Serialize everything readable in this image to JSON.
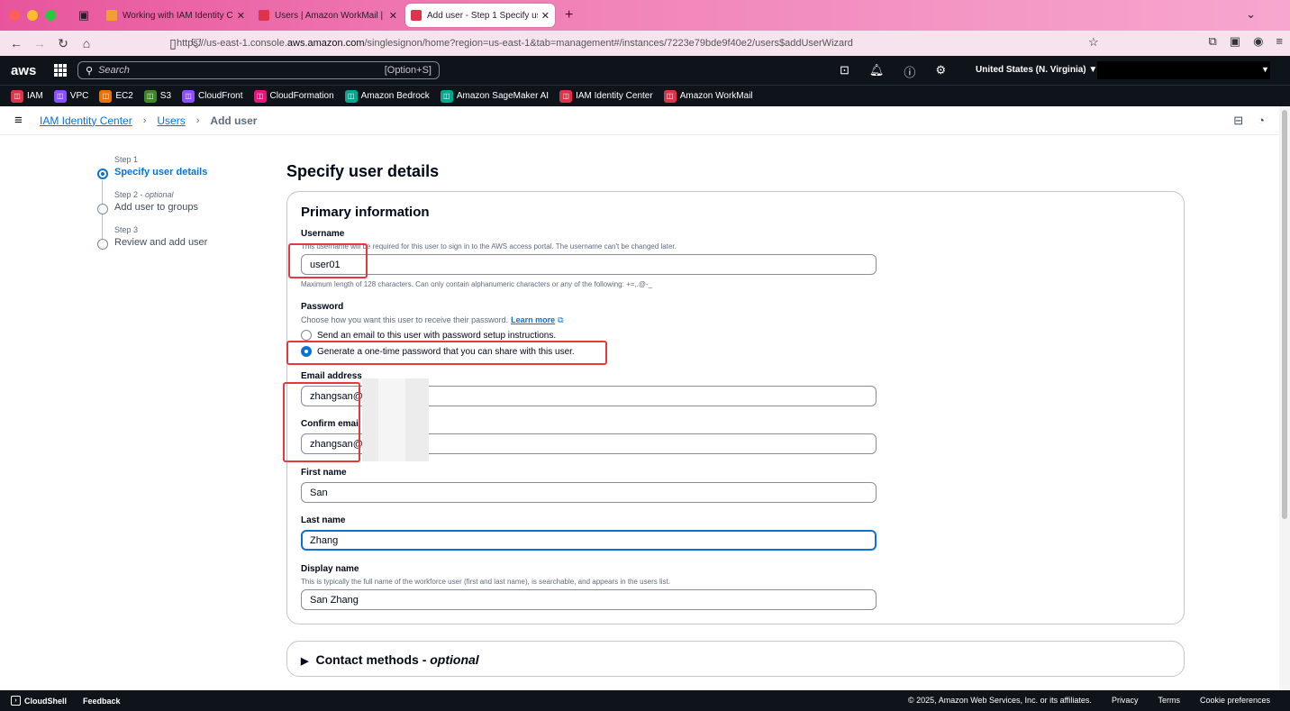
{
  "browser": {
    "tabs": [
      {
        "title": "Working with IAM Identity Cente",
        "favicon_color": "#f0a030"
      },
      {
        "title": "Users | Amazon WorkMail | us-e",
        "favicon_color": "#dd344c"
      },
      {
        "title": "Add user - Step 1 Specify user d",
        "favicon_color": "#dd344c",
        "active": true
      }
    ],
    "url_prefix": "https://us-east-1.console.",
    "url_domain": "aws.amazon.com",
    "url_suffix": "/singlesignon/home?region=us-east-1&tab=management#/instances/7223e79bde9f40e2/users$addUserWizard"
  },
  "aws_header": {
    "logo": "aws",
    "search_placeholder": "Search",
    "search_shortcut": "[Option+S]",
    "region": "United States (N. Virginia) ▼"
  },
  "favorites": [
    {
      "label": "IAM",
      "color": "#dd344c"
    },
    {
      "label": "VPC",
      "color": "#8c4fff"
    },
    {
      "label": "EC2",
      "color": "#ed7100"
    },
    {
      "label": "S3",
      "color": "#3f8624"
    },
    {
      "label": "CloudFront",
      "color": "#8c4fff"
    },
    {
      "label": "CloudFormation",
      "color": "#e7157b"
    },
    {
      "label": "Amazon Bedrock",
      "color": "#01a88d"
    },
    {
      "label": "Amazon SageMaker AI",
      "color": "#01a88d"
    },
    {
      "label": "IAM Identity Center",
      "color": "#dd344c"
    },
    {
      "label": "Amazon WorkMail",
      "color": "#dd344c"
    }
  ],
  "breadcrumb": {
    "root": "IAM Identity Center",
    "users": "Users",
    "current": "Add user"
  },
  "steps": [
    {
      "small": "Step 1",
      "name": "Specify user details"
    },
    {
      "small": "Step 2 - ",
      "optional": "optional",
      "name": "Add user to groups"
    },
    {
      "small": "Step 3",
      "name": "Review and add user"
    }
  ],
  "page_title": "Specify user details",
  "primary": {
    "title": "Primary information",
    "username_label": "Username",
    "username_desc": "This username will be required for this user to sign in to the AWS access portal. The username can't be changed later.",
    "username_value": "user01",
    "username_constraint": "Maximum length of 128 characters. Can only contain alphanumeric characters or any of the following: +=,.@-_",
    "password_label": "Password",
    "password_desc": "Choose how you want this user to receive their password.",
    "learn_more": "Learn more",
    "password_option_email": "Send an email to this user with password setup instructions.",
    "password_option_otp": "Generate a one-time password that you can share with this user.",
    "email_label": "Email address",
    "email_value": "zhangsan@t",
    "confirm_email_label": "Confirm email",
    "confirm_email_value": "zhangsan@t",
    "first_name_label": "First name",
    "first_name_value": "San",
    "last_name_label": "Last name",
    "last_name_value": "Zhang",
    "display_name_label": "Display name",
    "display_name_desc": "This is typically the full name of the workforce user (first and last name), is searchable, and appears in the users list.",
    "display_name_value": "San Zhang"
  },
  "contact": {
    "title": "Contact methods - ",
    "optional": "optional"
  },
  "footer": {
    "cloudshell": "CloudShell",
    "feedback": "Feedback",
    "copyright": "© 2025, Amazon Web Services, Inc. or its affiliates.",
    "privacy": "Privacy",
    "terms": "Terms",
    "cookies": "Cookie preferences"
  }
}
